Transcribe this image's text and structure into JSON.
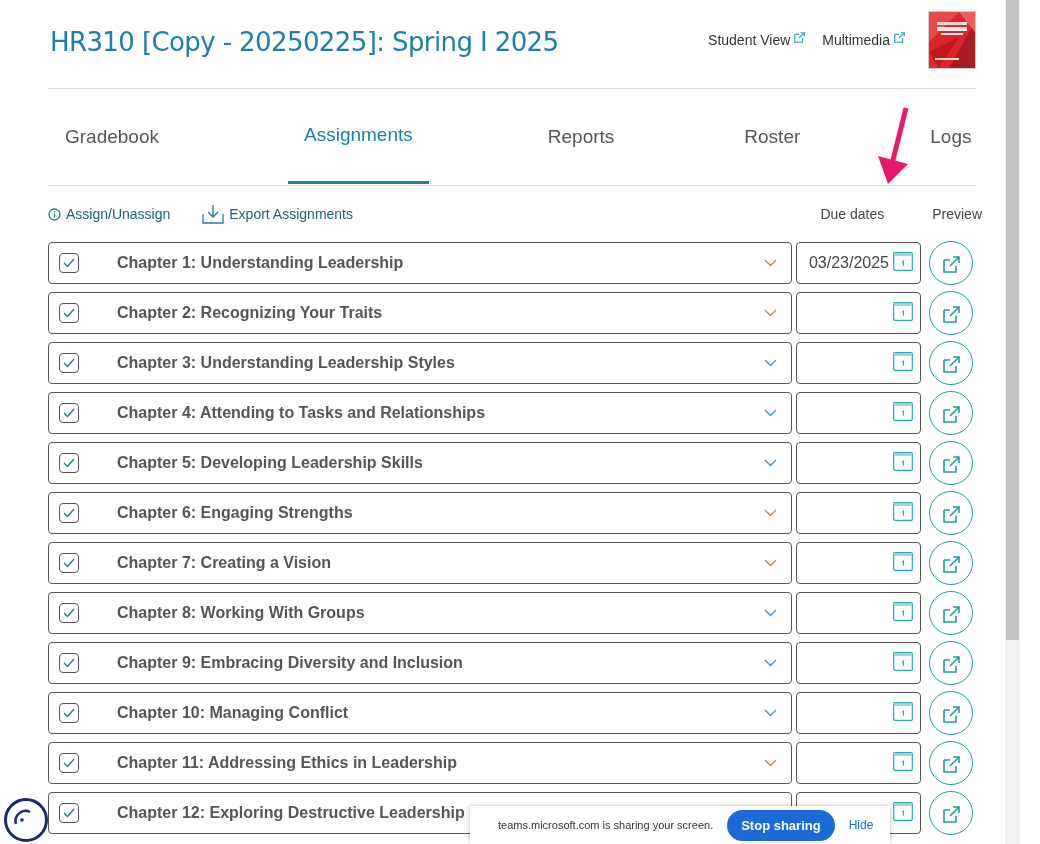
{
  "course": {
    "title": "HR310 [Copy - 20250225]: Spring I 2025",
    "links": [
      "Student View",
      "Multimedia"
    ]
  },
  "tabs": [
    {
      "label": "Gradebook",
      "selected": false
    },
    {
      "label": "Assignments",
      "selected": true
    },
    {
      "label": "Reports",
      "selected": false
    },
    {
      "label": "Roster",
      "selected": false
    },
    {
      "label": "Logs",
      "selected": false
    }
  ],
  "toolbar": {
    "assign": "Assign/Unassign",
    "export": "Export Assignments",
    "due_header": "Due dates",
    "preview_header": "Preview"
  },
  "chapters": [
    {
      "title": "Chapter 1: Understanding Leadership",
      "checked": true,
      "due": "03/23/2025",
      "color": "#b08a5a"
    },
    {
      "title": "Chapter 2: Recognizing Your Traits",
      "checked": true,
      "color": "#b08a5a"
    },
    {
      "title": "Chapter 3: Understanding Leadership Styles",
      "checked": true,
      "color": "#4a8fbf"
    },
    {
      "title": "Chapter 4: Attending to Tasks and Relationships",
      "checked": true,
      "color": "#4a8fbf"
    },
    {
      "title": "Chapter 5: Developing Leadership Skills",
      "checked": true,
      "color": "#4a8fbf"
    },
    {
      "title": "Chapter 6: Engaging Strengths",
      "checked": true,
      "color": "#b08a5a"
    },
    {
      "title": "Chapter 7: Creating a Vision",
      "checked": true,
      "color": "#b08a5a"
    },
    {
      "title": "Chapter 8: Working With Groups",
      "checked": true,
      "color": "#4a8fbf"
    },
    {
      "title": "Chapter 9: Embracing Diversity and Inclusion",
      "checked": true,
      "color": "#4a8fbf"
    },
    {
      "title": "Chapter 10: Managing Conflict",
      "checked": true,
      "color": "#4a8fbf"
    },
    {
      "title": "Chapter 11: Addressing Ethics in Leadership",
      "checked": true,
      "color": "#b08a5a"
    },
    {
      "title": "Chapter 12: Exploring Destructive Leadership",
      "checked": true
    }
  ],
  "share_bar": {
    "message": "teams.microsoft.com is sharing your screen.",
    "stop": "Stop sharing",
    "hide": "Hide"
  }
}
